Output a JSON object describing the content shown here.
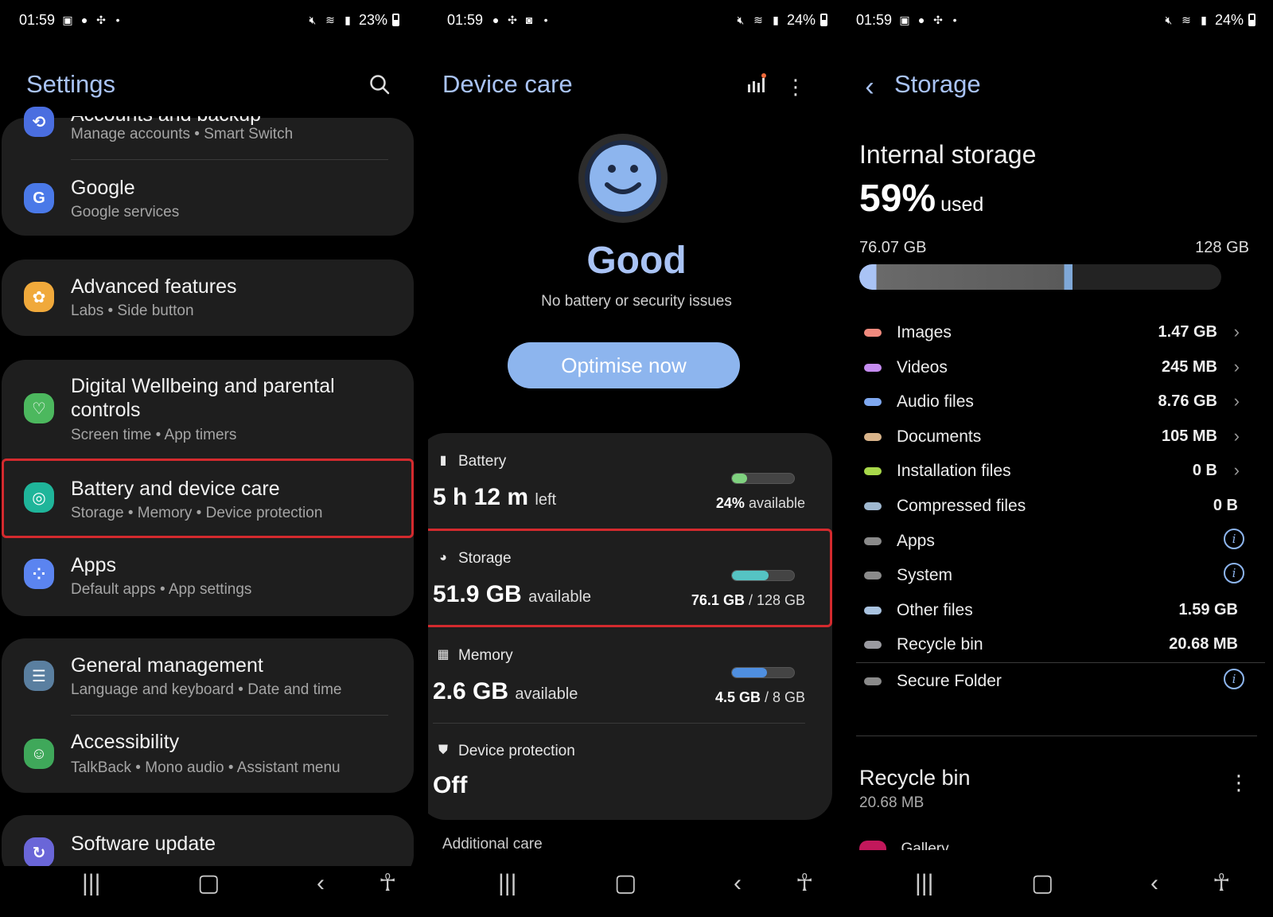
{
  "status_bars": [
    {
      "time": "01:59",
      "battery": "23%"
    },
    {
      "time": "01:59",
      "battery": "24%"
    },
    {
      "time": "01:59",
      "battery": "24%"
    }
  ],
  "settings": {
    "title": "Settings",
    "items": [
      {
        "title": "Accounts and backup",
        "subtitle_parts": [
          "Manage accounts",
          "Smart Switch"
        ]
      },
      {
        "title": "Google",
        "subtitle_parts": [
          "Google services"
        ]
      },
      {
        "title": "Advanced features",
        "subtitle_parts": [
          "Labs",
          "Side button"
        ]
      },
      {
        "title": "Digital Wellbeing and parental controls",
        "subtitle_parts": [
          "Screen time",
          "App timers"
        ]
      },
      {
        "title": "Battery and device care",
        "subtitle_parts": [
          "Storage",
          "Memory",
          "Device protection"
        ]
      },
      {
        "title": "Apps",
        "subtitle_parts": [
          "Default apps",
          "App settings"
        ]
      },
      {
        "title": "General management",
        "subtitle_parts": [
          "Language and keyboard",
          "Date and time"
        ]
      },
      {
        "title": "Accessibility",
        "subtitle_parts": [
          "TalkBack",
          "Mono audio",
          "Assistant menu"
        ]
      },
      {
        "title": "Software update",
        "subtitle_parts": []
      }
    ],
    "icon_colors": {
      "accounts": "#4a6ee0",
      "google": "#4a79e8",
      "advanced": "#f0a93b",
      "wellbeing": "#4cb85e",
      "battery": "#1fb59a",
      "apps": "#5b84f0",
      "general": "#5a7fa0",
      "accessibility": "#3fa85a",
      "software": "#6a66d8"
    }
  },
  "device_care": {
    "title": "Device care",
    "status": "Good",
    "status_sub": "No battery or security issues",
    "optimise_label": "Optimise now",
    "battery": {
      "label": "Battery",
      "value": "5 h 12 m",
      "unit": "left",
      "right_bold": "24%",
      "right_rest": " available",
      "fill_fraction": 0.24,
      "color": "#7fd17f"
    },
    "storage": {
      "label": "Storage",
      "value": "51.9 GB",
      "unit": "available",
      "right_bold": "76.1 GB",
      "right_rest": " / 128 GB",
      "fill_fraction": 0.59,
      "color": "#55c3c3"
    },
    "memory": {
      "label": "Memory",
      "value": "2.6 GB",
      "unit": "available",
      "right_bold": "4.5 GB",
      "right_rest": " / 8 GB",
      "fill_fraction": 0.56,
      "color": "#4f8fe0"
    },
    "protection": {
      "label": "Device protection",
      "value": "Off"
    },
    "additional": "Additional care"
  },
  "storage": {
    "title": "Storage",
    "internal_title": "Internal storage",
    "used_percent": "59%",
    "used_label": "used",
    "used_amount": "76.07 GB",
    "total": "128 GB",
    "used_fraction": 0.59,
    "categories": [
      {
        "name": "Images",
        "value": "1.47 GB",
        "color": "#f08a7e",
        "trail": "chevron"
      },
      {
        "name": "Videos",
        "value": "245 MB",
        "color": "#c58cf0",
        "trail": "chevron"
      },
      {
        "name": "Audio files",
        "value": "8.76 GB",
        "color": "#7fa8f0",
        "trail": "chevron"
      },
      {
        "name": "Documents",
        "value": "105 MB",
        "color": "#d9b48a",
        "trail": "chevron"
      },
      {
        "name": "Installation files",
        "value": "0 B",
        "color": "#a8d84a",
        "trail": "chevron"
      },
      {
        "name": "Compressed files",
        "value": "0 B",
        "color": "#9fb8d0",
        "trail": "none"
      },
      {
        "name": "Apps",
        "value": "",
        "color": "#8a8a8a",
        "trail": "info"
      },
      {
        "name": "System",
        "value": "",
        "color": "#8a8a8a",
        "trail": "info"
      },
      {
        "name": "Other files",
        "value": "1.59 GB",
        "color": "#a9c3e0",
        "trail": "none"
      },
      {
        "name": "Recycle bin",
        "value": "20.68 MB",
        "color": "#9a9aa0",
        "trail": "none"
      },
      {
        "name": "Secure Folder",
        "value": "",
        "color": "#8a8a8a",
        "trail": "info"
      }
    ],
    "recycle_title": "Recycle bin",
    "recycle_size": "20.68 MB",
    "gallery_label": "Gallery"
  },
  "accent_color": "#a9c3f5",
  "highlight_color": "#d42a2e"
}
